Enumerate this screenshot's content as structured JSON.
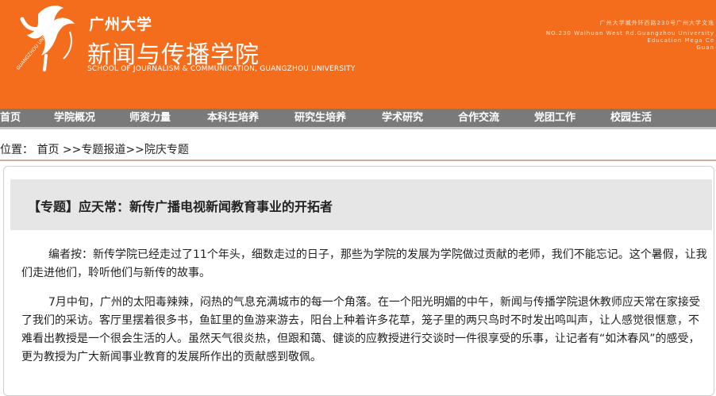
{
  "header": {
    "univ_cn": "广州大学",
    "school_cn": "新闻与传播学院",
    "school_en": "SCHOOL OF JOURNALISM & COMMUNICATION, GUANGZHOU UNIVERSITY",
    "logo_text": "GUANGZHOU UNIVERSITY",
    "address_lines": [
      "广州大学城外环西路230号广州大学文逸",
      "NO.230 Waihuan West Rd.Guangzhou University",
      "Education Mega Ce",
      "Guan"
    ],
    "brand_color": "#f36d1c"
  },
  "nav": {
    "items": [
      "首页",
      "学院概况",
      "师资力量",
      "本科生培养",
      "研究生培养",
      "学术研究",
      "合作交流",
      "党团工作",
      "校园生活"
    ]
  },
  "location": {
    "label": "位置：",
    "home": "首页",
    "sep1": ">>",
    "crumb1": "专题报道",
    "sep2": ">>",
    "crumb2": "院庆专题"
  },
  "article": {
    "title": "【专题】应天常：新传广播电视新闻教育事业的开拓者",
    "paragraphs": [
      "编者按：新传学院已经走过了11个年头，细数走过的日子，那些为学院的发展为学院做过贡献的老师，我们不能忘记。这个暑假，让我们走进他们，聆听他们与新传的故事。",
      "7月中旬，广州的太阳毒辣辣，闷热的气息充满城市的每一个角落。在一个阳光明媚的中午，新闻与传播学院退休教师应天常在家接受了我们的采访。客厅里摆着很多书，鱼缸里的鱼游来游去，阳台上种着许多花草，笼子里的两只鸟时不时发出鸣叫声，让人感觉很惬意，不难看出教授是一个很会生活的人。虽然天气很炎热，但跟和蔼、健谈的应教授进行交谈时一件很享受的乐事，让记者有“如沐春风”的感受，更为教授为广大新闻事业教育的发展所作出的贡献感到敬佩。"
    ]
  }
}
